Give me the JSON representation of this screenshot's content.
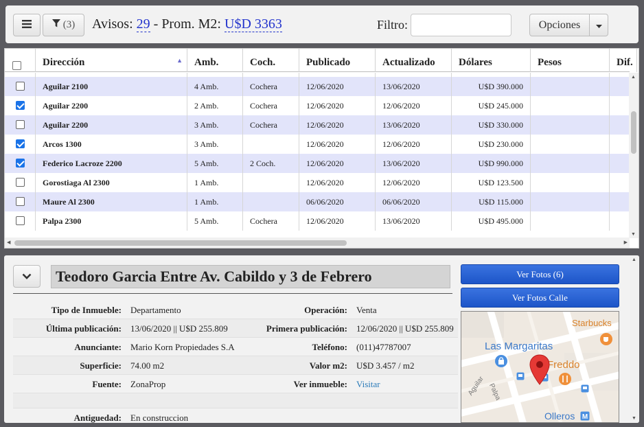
{
  "toolbar": {
    "filter_count": "(3)",
    "avisos_label": "Avisos:",
    "avisos_count": "29",
    "separator": "-",
    "prom_label": "Prom. M2:",
    "prom_value": "U$D 3363",
    "filtro_label": "Filtro:",
    "filtro_value": "",
    "opciones_label": "Opciones"
  },
  "grid": {
    "columns": [
      "Dirección",
      "Amb.",
      "Coch.",
      "Publicado",
      "Actualizado",
      "Dólares",
      "Pesos",
      "Dif."
    ],
    "sorted_column": "Dirección",
    "rows": [
      {
        "checked": false,
        "direccion": "Aguilar 2100",
        "amb": "4 Amb.",
        "coch": "Cochera",
        "publicado": "12/06/2020",
        "actualizado": "13/06/2020",
        "dolares": "U$D 390.000",
        "pesos": "",
        "dif": ""
      },
      {
        "checked": true,
        "direccion": "Aguilar 2200",
        "amb": "2 Amb.",
        "coch": "Cochera",
        "publicado": "12/06/2020",
        "actualizado": "12/06/2020",
        "dolares": "U$D 245.000",
        "pesos": "",
        "dif": ""
      },
      {
        "checked": false,
        "direccion": "Aguilar 2200",
        "amb": "3 Amb.",
        "coch": "Cochera",
        "publicado": "12/06/2020",
        "actualizado": "13/06/2020",
        "dolares": "U$D 330.000",
        "pesos": "",
        "dif": ""
      },
      {
        "checked": true,
        "direccion": "Arcos 1300",
        "amb": "3 Amb.",
        "coch": "",
        "publicado": "12/06/2020",
        "actualizado": "12/06/2020",
        "dolares": "U$D 230.000",
        "pesos": "",
        "dif": ""
      },
      {
        "checked": true,
        "direccion": "Federico Lacroze 2200",
        "amb": "5 Amb.",
        "coch": "2 Coch.",
        "publicado": "12/06/2020",
        "actualizado": "13/06/2020",
        "dolares": "U$D 990.000",
        "pesos": "",
        "dif": ""
      },
      {
        "checked": false,
        "direccion": "Gorostiaga Al 2300",
        "amb": "1 Amb.",
        "coch": "",
        "publicado": "12/06/2020",
        "actualizado": "12/06/2020",
        "dolares": "U$D 123.500",
        "pesos": "",
        "dif": ""
      },
      {
        "checked": false,
        "direccion": "Maure Al 2300",
        "amb": "1 Amb.",
        "coch": "",
        "publicado": "06/06/2020",
        "actualizado": "06/06/2020",
        "dolares": "U$D 115.000",
        "pesos": "",
        "dif": ""
      },
      {
        "checked": false,
        "direccion": "Palpa 2300",
        "amb": "5 Amb.",
        "coch": "Cochera",
        "publicado": "12/06/2020",
        "actualizado": "13/06/2020",
        "dolares": "U$D 495.000",
        "pesos": "",
        "dif": ""
      }
    ]
  },
  "detail": {
    "address": "Teodoro Garcia Entre Av. Cabildo y 3 de Febrero",
    "fotos_button": "Ver Fotos (6)",
    "fotos_calle_button": "Ver Fotos Calle",
    "fields": {
      "tipo_label": "Tipo de Inmueble:",
      "tipo_value": "Departamento",
      "operacion_label": "Operación:",
      "operacion_value": "Venta",
      "ultima_label": "Última publicación:",
      "ultima_value": "13/06/2020 || U$D 255.809",
      "primera_label": "Primera publicación:",
      "primera_value": "12/06/2020 || U$D 255.809",
      "anunciante_label": "Anunciante:",
      "anunciante_value": "Mario Korn Propiedades S.A",
      "telefono_label": "Teléfono:",
      "telefono_value": "(011)47787007",
      "superficie_label": "Superficie:",
      "superficie_value": "74.00 m2",
      "valorm2_label": "Valor m2:",
      "valorm2_value": "U$D 3.457 / m2",
      "fuente_label": "Fuente:",
      "fuente_value": "ZonaProp",
      "ver_label": "Ver inmueble:",
      "ver_value": "Visitar",
      "antiguedad_label": "Antiguedad:",
      "antiguedad_value": "En construccion"
    },
    "map": {
      "labels": {
        "starbucks": "Starbucks",
        "las_margaritas": "Las Margaritas",
        "freddo": "Freddo",
        "aguilar": "Aguilar",
        "palpa": "Palpa",
        "olleros": "Olleros"
      },
      "colors": {
        "pin": "#e53935",
        "poi_blue": "#4a8fe0",
        "poi_orange": "#f0903a",
        "land": "#efe9e1"
      }
    }
  }
}
